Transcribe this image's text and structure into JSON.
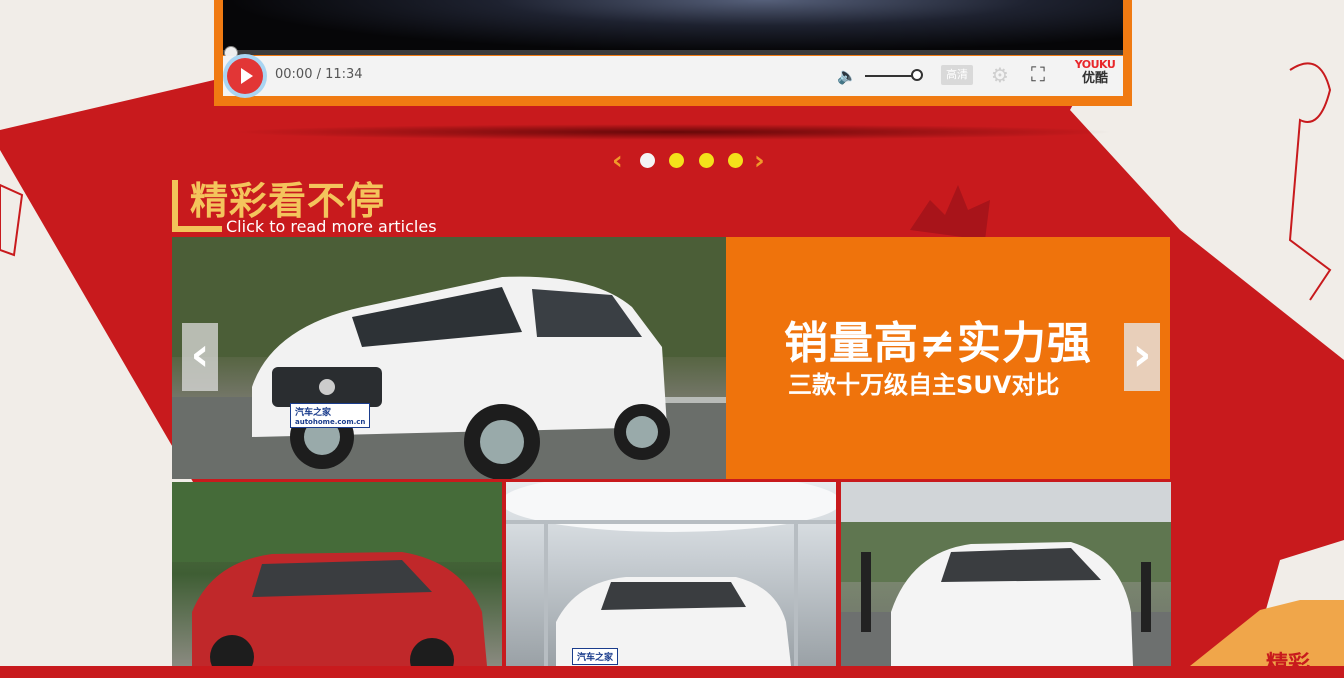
{
  "player": {
    "time": "00:00 / 11:34",
    "quality_label": "高清",
    "brand_en": "YOUKU",
    "brand_cn": "优酷",
    "progress": 0
  },
  "carousel_dots": {
    "count": 4,
    "active_index": 0
  },
  "section": {
    "title": "精彩看不停",
    "subtitle": "Click to read more articles"
  },
  "banner": {
    "headline": "销量高≠实力强",
    "subheadline": "三款十万级自主SUV对比",
    "watermark": "汽车之家",
    "watermark_url": "autohome.com.cn"
  },
  "thumbnails": [
    {
      "name": "red-suv",
      "car_color": "#c0282a"
    },
    {
      "name": "white-suv-canopy",
      "car_color": "#f4f4f4",
      "watermark": "汽车之家"
    },
    {
      "name": "white-suv-event",
      "car_color": "#f4f4f4"
    }
  ],
  "colors": {
    "background_red": "#c81a1d",
    "accent_orange": "#ef730c",
    "dot_yellow": "#f4e11a",
    "title_gold": "#f4c45c"
  },
  "corner_text": "精彩"
}
